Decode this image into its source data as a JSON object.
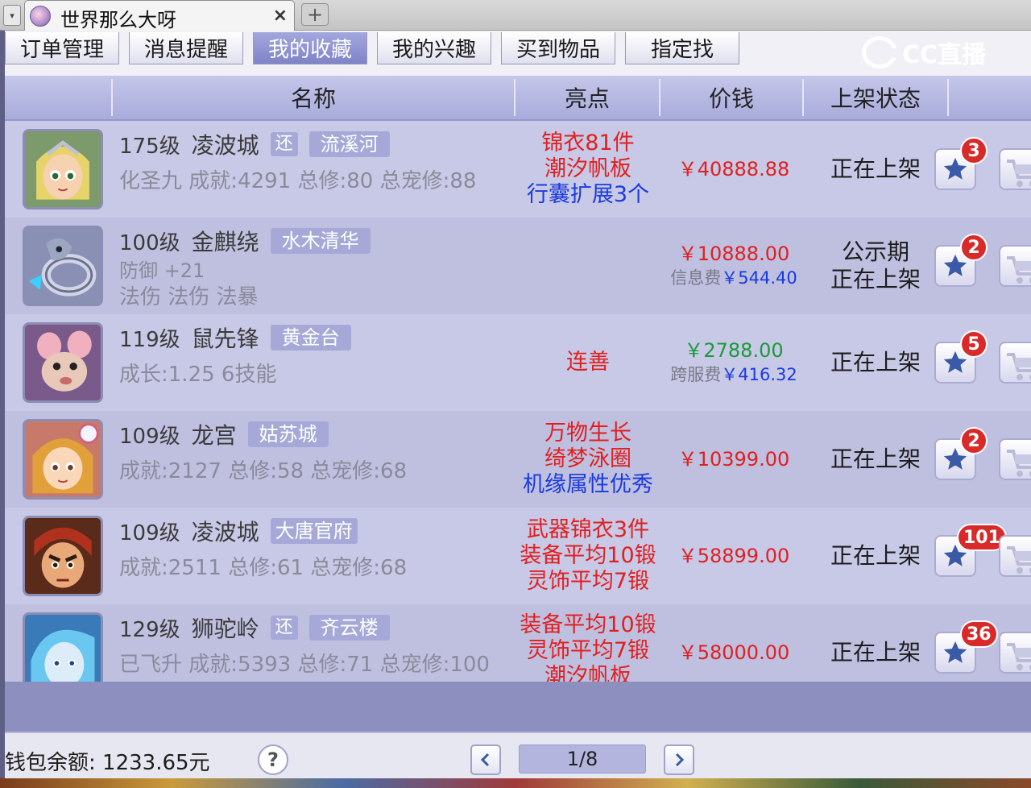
{
  "browser": {
    "tab_title": "世界那么大呀",
    "tab_close": "×",
    "new_tab": "+",
    "menu_glyph": "▾"
  },
  "nav": {
    "tabs": [
      {
        "label": "订单管理",
        "active": false
      },
      {
        "label": "消息提醒",
        "active": false
      },
      {
        "label": "我的收藏",
        "active": true
      },
      {
        "label": "我的兴趣",
        "active": false
      },
      {
        "label": "买到物品",
        "active": false
      },
      {
        "label": "指定找",
        "active": false
      }
    ],
    "logo_text": "CC直播"
  },
  "table": {
    "headers": {
      "name": "名称",
      "highlight": "亮点",
      "price": "价钱",
      "status": "上架状态"
    },
    "rows": [
      {
        "level": "175级",
        "school": "凌波城",
        "tag_small": "还",
        "server": "流溪河",
        "stats": "化圣九  成就:4291  总修:80  总宠修:88",
        "highlights": [
          {
            "text": "锦衣81件",
            "color": "red"
          },
          {
            "text": "潮汐帆板",
            "color": "red"
          },
          {
            "text": "行囊扩展3个",
            "color": "blue"
          }
        ],
        "price": "￥40888.88",
        "price_color": "#e02020",
        "fee_label": "",
        "fee_value": "",
        "status": [
          "正在上架"
        ],
        "fav_count": "3",
        "avatar": "fairy"
      },
      {
        "level": "100级",
        "school": "金麒绕",
        "tag_small": "",
        "server": "水木清华",
        "stats": "防御 +21",
        "stats2": "法伤  法伤  法暴",
        "highlights": [],
        "price": "￥10888.00",
        "price_color": "#e02020",
        "fee_label": "信息费",
        "fee_value": "￥544.40",
        "status": [
          "公示期",
          "正在上架"
        ],
        "fav_count": "2",
        "avatar": "ring"
      },
      {
        "level": "119级",
        "school": "鼠先锋",
        "tag_small": "",
        "server": "黄金台",
        "stats": "成长:1.25  6技能",
        "highlights": [
          {
            "text": "连善",
            "color": "red"
          }
        ],
        "price": "￥2788.00",
        "price_color": "#1a9a3a",
        "fee_label": "跨服费",
        "fee_value": "￥416.32",
        "status": [
          "正在上架"
        ],
        "fav_count": "5",
        "avatar": "rat"
      },
      {
        "level": "109级",
        "school": "龙宫",
        "tag_small": "",
        "server": "姑苏城",
        "stats": "成就:2127  总修:58  总宠修:68",
        "highlights": [
          {
            "text": "万物生长",
            "color": "red"
          },
          {
            "text": "绮梦泳圈",
            "color": "red"
          },
          {
            "text": "机缘属性优秀",
            "color": "blue"
          }
        ],
        "price": "￥10399.00",
        "price_color": "#e02020",
        "fee_label": "",
        "fee_value": "",
        "status": [
          "正在上架"
        ],
        "fav_count": "2",
        "avatar": "girl"
      },
      {
        "level": "109级",
        "school": "凌波城",
        "tag_small": "",
        "server": "大唐官府",
        "stats": "成就:2511  总修:61  总宠修:68",
        "highlights": [
          {
            "text": "武器锦衣3件",
            "color": "red"
          },
          {
            "text": "装备平均10锻",
            "color": "red"
          },
          {
            "text": "灵饰平均7锻",
            "color": "red"
          }
        ],
        "price": "￥58899.00",
        "price_color": "#e02020",
        "fee_label": "",
        "fee_value": "",
        "status": [
          "正在上架"
        ],
        "fav_count": "101",
        "avatar": "warrior"
      },
      {
        "level": "129级",
        "school": "狮驼岭",
        "tag_small": "还",
        "server": "齐云楼",
        "stats": "已飞升  成就:5393  总修:71  总宠修:100",
        "highlights": [
          {
            "text": "装备平均10锻",
            "color": "red"
          },
          {
            "text": "灵饰平均7锻",
            "color": "red"
          },
          {
            "text": "潮汐帆板",
            "color": "red"
          }
        ],
        "price": "￥58000.00",
        "price_color": "#e02020",
        "fee_label": "",
        "fee_value": "",
        "status": [
          "正在上架"
        ],
        "fav_count": "36",
        "avatar": "blue"
      }
    ]
  },
  "footer": {
    "wallet": "钱包余额: 1233.65元",
    "help": "?",
    "page": "1/8"
  },
  "icons": {
    "star": "star-icon",
    "cart": "cart-icon",
    "prev": "chevron-left-icon",
    "next": "chevron-right-icon"
  },
  "colors": {
    "accent": "#8f93d3",
    "row_a": "#c8c9e6",
    "row_b": "#bfc0e0",
    "price_red": "#e02020",
    "price_green": "#1a9a3a",
    "badge_red": "#d92a2a",
    "star_blue": "#3a5aa8"
  }
}
